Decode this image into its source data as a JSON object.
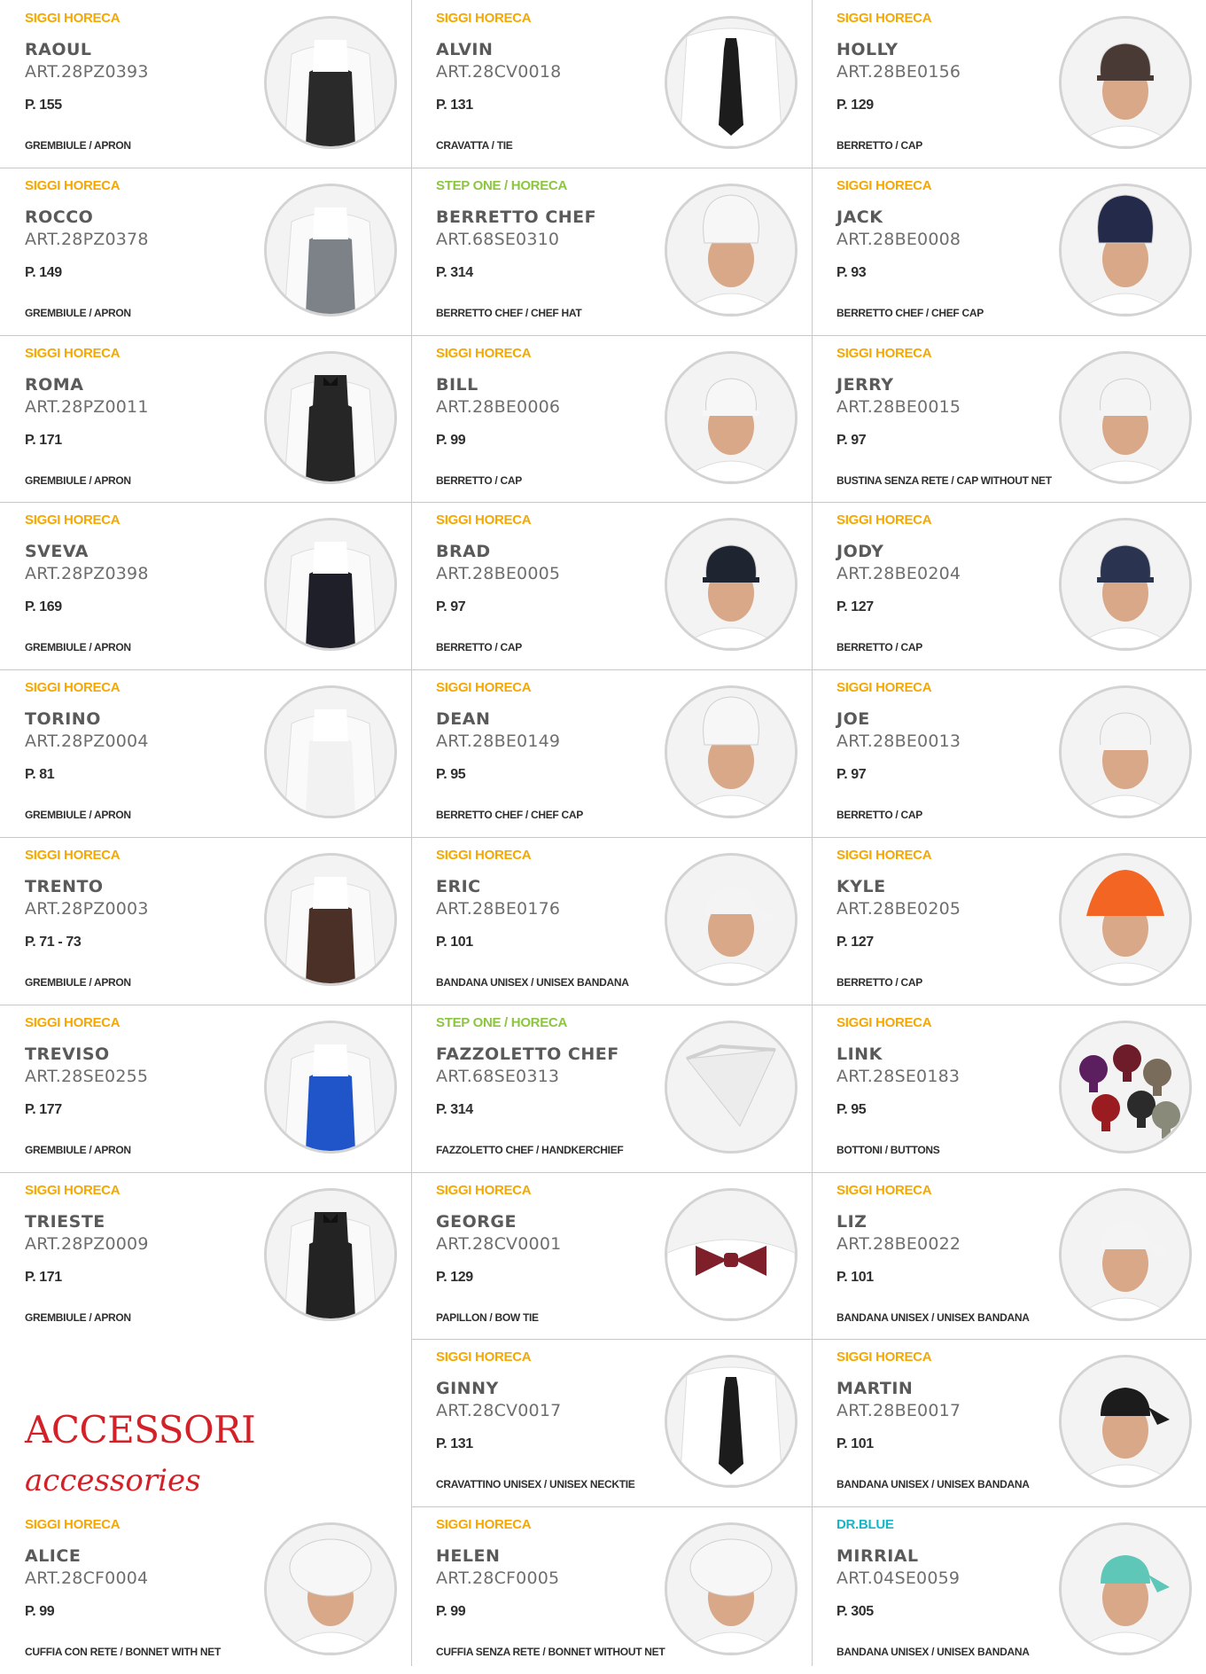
{
  "colors": {
    "siggi_horeca": "#f5a800",
    "step_one": "#8cc63f",
    "dr_blue": "#19b5c6",
    "section_red": "#d42027",
    "divider": "#c8c8c8"
  },
  "section_heading": {
    "title": "ACCESSORI",
    "subtitle": "accessories"
  },
  "columns": [
    [
      {
        "brand": "SIGGI HORECA",
        "brand_style": "siggi",
        "name": "RAOUL",
        "art": "ART.28PZ0393",
        "page": "P. 155",
        "category": "GREMBIULE / APRON",
        "image": "apron-black",
        "image_color": "#2a2a2a"
      },
      {
        "brand": "SIGGI HORECA",
        "brand_style": "siggi",
        "name": "ROCCO",
        "art": "ART.28PZ0378",
        "page": "P. 149",
        "category": "GREMBIULE / APRON",
        "image": "apron-grey",
        "image_color": "#7c8288"
      },
      {
        "brand": "SIGGI HORECA",
        "brand_style": "siggi",
        "name": "ROMA",
        "art": "ART.28PZ0011",
        "page": "P. 171",
        "category": "GREMBIULE / APRON",
        "image": "vest-apron-black",
        "image_color": "#262626"
      },
      {
        "brand": "SIGGI HORECA",
        "brand_style": "siggi",
        "name": "SVEVA",
        "art": "ART.28PZ0398",
        "page": "P. 169",
        "category": "GREMBIULE / APRON",
        "image": "apron-black-woman",
        "image_color": "#1f1f2a"
      },
      {
        "brand": "SIGGI HORECA",
        "brand_style": "siggi",
        "name": "TORINO",
        "art": "ART.28PZ0004",
        "page": "P. 81",
        "category": "GREMBIULE / APRON",
        "image": "apron-white",
        "image_color": "#f2f2f2"
      },
      {
        "brand": "SIGGI HORECA",
        "brand_style": "siggi",
        "name": "TRENTO",
        "art": "ART.28PZ0003",
        "page": "P. 71 - 73",
        "category": "GREMBIULE / APRON",
        "image": "apron-brown",
        "image_color": "#4a3026"
      },
      {
        "brand": "SIGGI HORECA",
        "brand_style": "siggi",
        "name": "TREVISO",
        "art": "ART.28SE0255",
        "page": "P. 177",
        "category": "GREMBIULE / APRON",
        "image": "apron-blue",
        "image_color": "#1f55c8"
      },
      {
        "brand": "SIGGI HORECA",
        "brand_style": "siggi",
        "name": "TRIESTE",
        "art": "ART.28PZ0009",
        "page": "P. 171",
        "category": "GREMBIULE / APRON",
        "image": "vest-apron-black",
        "image_color": "#232323"
      },
      null,
      {
        "brand": "SIGGI HORECA",
        "brand_style": "siggi",
        "name": "ALICE",
        "art": "ART.28CF0004",
        "page": "P. 99",
        "category": "CUFFIA CON RETE / BONNET WITH NET",
        "image": "bonnet-net",
        "image_color": "#f7f7f7"
      }
    ],
    [
      {
        "brand": "SIGGI HORECA",
        "brand_style": "siggi",
        "name": "ALVIN",
        "art": "ART.28CV0018",
        "page": "P. 131",
        "category": "CRAVATTA / TIE",
        "image": "tie-black",
        "image_color": "#1c1c1c"
      },
      {
        "brand": "STEP ONE / HORECA",
        "brand_style": "stepone",
        "name": "BERRETTO CHEF",
        "art": "ART.68SE0310",
        "page": "P. 314",
        "category": "BERRETTO CHEF / CHEF HAT",
        "image": "chef-hat-tall",
        "image_color": "#f7f7f7"
      },
      {
        "brand": "SIGGI HORECA",
        "brand_style": "siggi",
        "name": "BILL",
        "art": "ART.28BE0006",
        "page": "P. 99",
        "category": "BERRETTO / CAP",
        "image": "cap-white",
        "image_color": "#f7f7f7"
      },
      {
        "brand": "SIGGI HORECA",
        "brand_style": "siggi",
        "name": "BRAD",
        "art": "ART.28BE0005",
        "page": "P. 97",
        "category": "BERRETTO / CAP",
        "image": "cap-black",
        "image_color": "#1e2430"
      },
      {
        "brand": "SIGGI HORECA",
        "brand_style": "siggi",
        "name": "DEAN",
        "art": "ART.28BE0149",
        "page": "P. 95",
        "category": "BERRETTO CHEF / CHEF CAP",
        "image": "chef-hat-white",
        "image_color": "#f7f7f7"
      },
      {
        "brand": "SIGGI HORECA",
        "brand_style": "siggi",
        "name": "ERIC",
        "art": "ART.28BE0176",
        "page": "P. 101",
        "category": "BANDANA UNISEX / UNISEX BANDANA",
        "image": "bandana-white",
        "image_color": "#f4f4f4"
      },
      {
        "brand": "STEP ONE / HORECA",
        "brand_style": "stepone",
        "name": "FAZZOLETTO CHEF",
        "art": "ART.68SE0313",
        "page": "P. 314",
        "category": "FAZZOLETTO CHEF / HANDKERCHIEF",
        "image": "handkerchief-white",
        "image_color": "#ececec"
      },
      {
        "brand": "SIGGI HORECA",
        "brand_style": "siggi",
        "name": "GEORGE",
        "art": "ART.28CV0001",
        "page": "P. 129",
        "category": "PAPILLON / BOW TIE",
        "image": "bow-tie-red",
        "image_color": "#7e1f2a"
      },
      {
        "brand": "SIGGI HORECA",
        "brand_style": "siggi",
        "name": "GINNY",
        "art": "ART.28CV0017",
        "page": "P. 131",
        "category": "CRAVATTINO UNISEX / UNISEX NECKTIE",
        "image": "necktie-black",
        "image_color": "#1c1c1c"
      },
      {
        "brand": "SIGGI HORECA",
        "brand_style": "siggi",
        "name": "HELEN",
        "art": "ART.28CF0005",
        "page": "P. 99",
        "category": "CUFFIA SENZA RETE / BONNET WITHOUT NET",
        "image": "bonnet-white",
        "image_color": "#f7f7f7"
      }
    ],
    [
      {
        "brand": "SIGGI HORECA",
        "brand_style": "siggi",
        "name": "HOLLY",
        "art": "ART.28BE0156",
        "page": "P. 129",
        "category": "BERRETTO / CAP",
        "image": "cap-brown",
        "image_color": "#4a3a35"
      },
      {
        "brand": "SIGGI HORECA",
        "brand_style": "siggi",
        "name": "JACK",
        "art": "ART.28BE0008",
        "page": "P. 93",
        "category": "BERRETTO CHEF / CHEF CAP",
        "image": "chef-hat-navy",
        "image_color": "#232a4a"
      },
      {
        "brand": "SIGGI HORECA",
        "brand_style": "siggi",
        "name": "JERRY",
        "art": "ART.28BE0015",
        "page": "P. 97",
        "category": "BUSTINA SENZA RETE / CAP WITHOUT NET",
        "image": "cap-white",
        "image_color": "#f4f4f4"
      },
      {
        "brand": "SIGGI HORECA",
        "brand_style": "siggi",
        "name": "JODY",
        "art": "ART.28BE0204",
        "page": "P. 127",
        "category": "BERRETTO / CAP",
        "image": "cap-navy",
        "image_color": "#2a3350"
      },
      {
        "brand": "SIGGI HORECA",
        "brand_style": "siggi",
        "name": "JOE",
        "art": "ART.28BE0013",
        "page": "P. 97",
        "category": "BERRETTO / CAP",
        "image": "cap-white",
        "image_color": "#f4f4f4"
      },
      {
        "brand": "SIGGI HORECA",
        "brand_style": "siggi",
        "name": "KYLE",
        "art": "ART.28BE0205",
        "page": "P. 127",
        "category": "BERRETTO / CAP",
        "image": "hat-orange",
        "image_color": "#f26522"
      },
      {
        "brand": "SIGGI HORECA",
        "brand_style": "siggi",
        "name": "LINK",
        "art": "ART.28SE0183",
        "page": "P. 95",
        "category": "BOTTONI / BUTTONS",
        "image": "buttons",
        "image_color": "#5a1e2a"
      },
      {
        "brand": "SIGGI HORECA",
        "brand_style": "siggi",
        "name": "LIZ",
        "art": "ART.28BE0022",
        "page": "P. 101",
        "category": "BANDANA UNISEX / UNISEX BANDANA",
        "image": "bandana-white",
        "image_color": "#f4f4f4"
      },
      {
        "brand": "SIGGI HORECA",
        "brand_style": "siggi",
        "name": "MARTIN",
        "art": "ART.28BE0017",
        "page": "P. 101",
        "category": "BANDANA UNISEX / UNISEX BANDANA",
        "image": "bandana-black",
        "image_color": "#1c1c1c"
      },
      {
        "brand": "DR.BLUE",
        "brand_style": "drblue",
        "name": "MIRRIAL",
        "art": "ART.04SE0059",
        "page": "P. 305",
        "category": "BANDANA UNISEX / UNISEX BANDANA",
        "image": "bandana-teal",
        "image_color": "#5fc7b8"
      }
    ]
  ]
}
